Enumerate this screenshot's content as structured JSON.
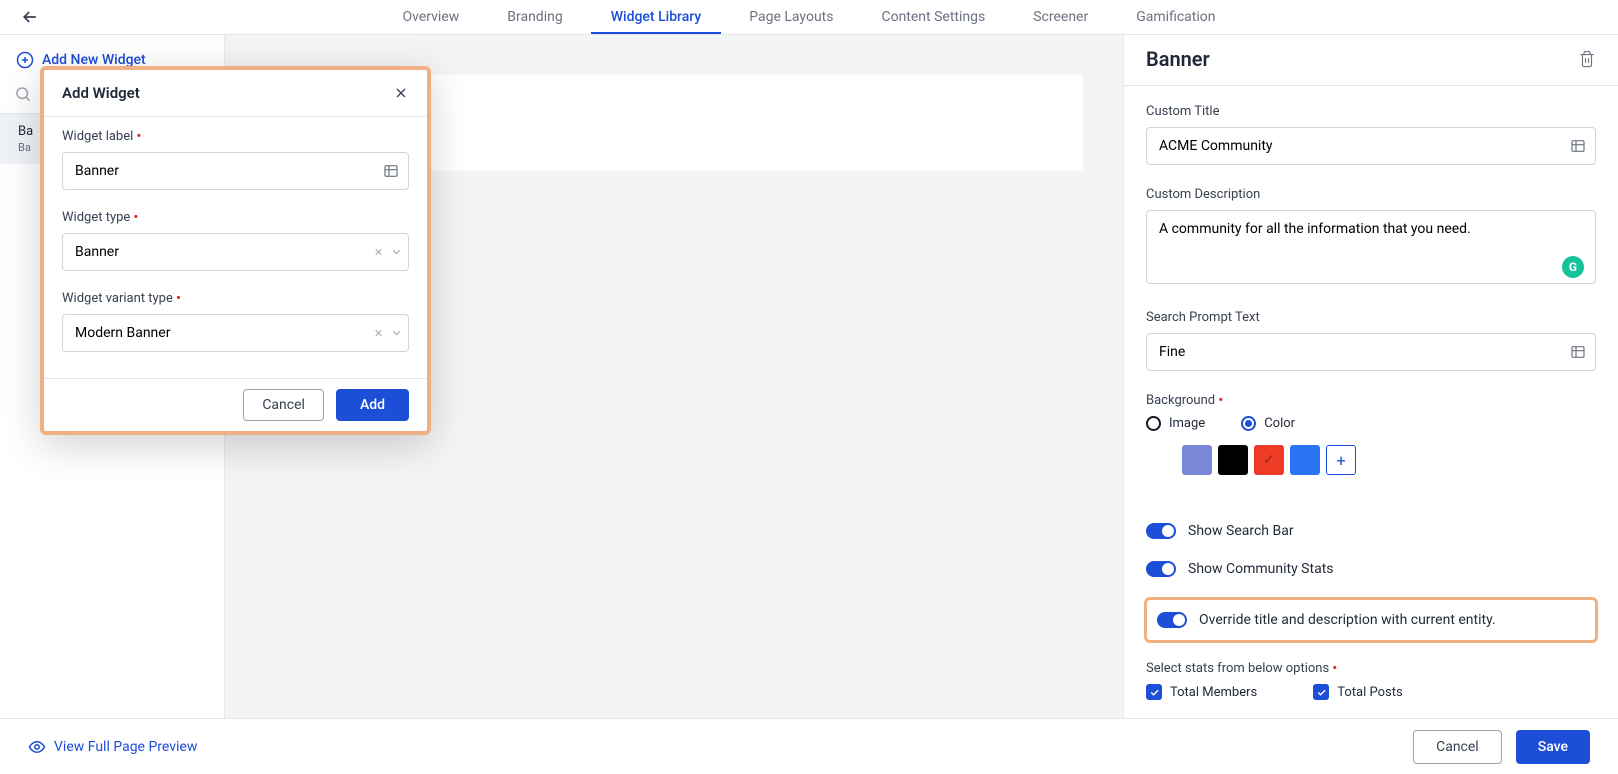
{
  "nav": {
    "tabs": {
      "overview": "Overview",
      "branding": "Branding",
      "widget_library": "Widget Library",
      "page_layouts": "Page Layouts",
      "content_settings": "Content Settings",
      "screener": "Screener",
      "gamification": "Gamification"
    }
  },
  "sidebar": {
    "add_new": "Add New Widget",
    "item": {
      "title_short": "Ba",
      "sub_short": "Ba"
    }
  },
  "modal": {
    "title": "Add Widget",
    "labels": {
      "widget_label": "Widget label",
      "widget_type": "Widget type",
      "widget_variant_type": "Widget variant type"
    },
    "values": {
      "widget_label": "Banner",
      "widget_type": "Banner",
      "widget_variant_type": "Modern Banner"
    },
    "buttons": {
      "cancel": "Cancel",
      "add": "Add"
    }
  },
  "right": {
    "title": "Banner",
    "labels": {
      "custom_title": "Custom Title",
      "custom_description": "Custom Description",
      "search_prompt": "Search Prompt Text",
      "background": "Background",
      "image": "Image",
      "color": "Color",
      "show_search": "Show Search Bar",
      "show_stats": "Show Community Stats",
      "override": "Override title and description with current entity.",
      "select_stats": "Select stats from below options",
      "total_members": "Total Members",
      "total_posts": "Total Posts"
    },
    "values": {
      "custom_title": "ACME Community",
      "custom_description": "A community for all the information that you need.",
      "search_prompt": "Fine"
    },
    "colors": {
      "c1": "#173acc",
      "c2": "#7a87d6",
      "c3": "#000000",
      "c4": "#ee3b24",
      "c5": "#2a75f3"
    }
  },
  "footer": {
    "preview": "View Full Page Preview",
    "cancel": "Cancel",
    "save": "Save"
  }
}
